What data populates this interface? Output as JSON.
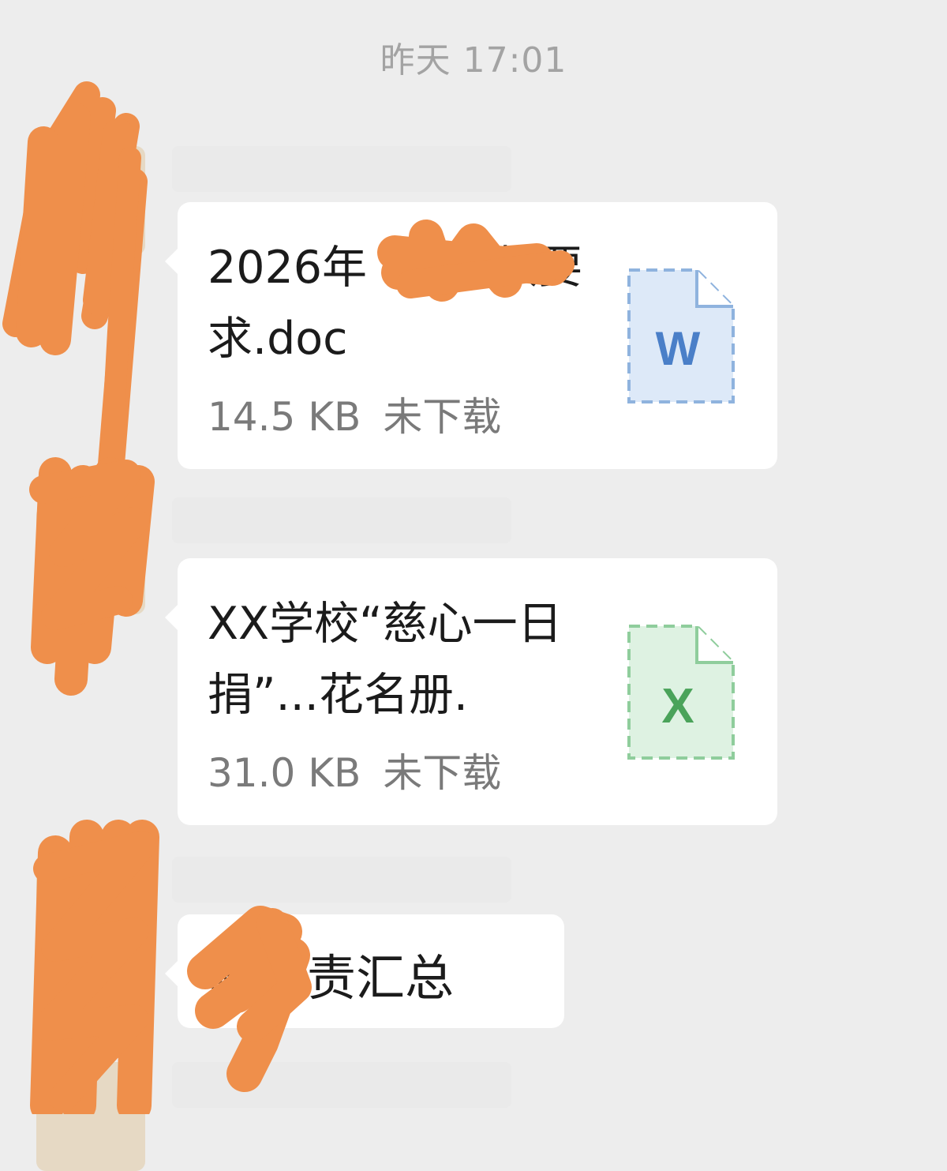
{
  "timestamp": "昨天 17:01",
  "messages": [
    {
      "type": "file",
      "file_name": "2026年 “...捐款要求.doc",
      "size": "14.5 KB",
      "status": "未下载",
      "icon": "word-file-icon",
      "icon_letter": "W",
      "icon_color": "#4a7fc8"
    },
    {
      "type": "file",
      "file_name": "XX学校“慈心一日捐”...花名册.",
      "size": "31.0 KB",
      "status": "未下载",
      "icon": "excel-file-icon",
      "icon_letter": "X",
      "icon_color": "#4aa35a"
    },
    {
      "type": "text",
      "text": "校负责汇总"
    }
  ],
  "redaction_color": "#ef8f4b"
}
